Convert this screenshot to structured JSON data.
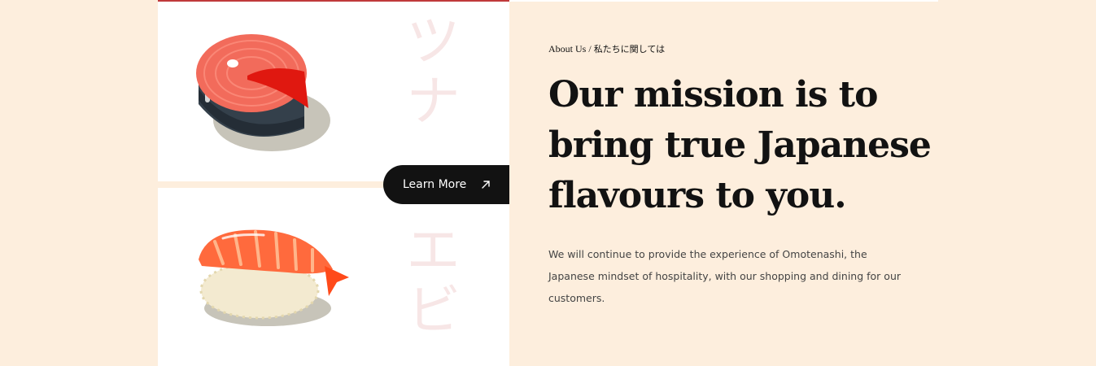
{
  "about": {
    "breadcrumb_en": "About Us",
    "breadcrumb_sep": "/",
    "breadcrumb_jp": "私たちに関しては",
    "headline": "Our mission is to bring true Japanese flavours to you.",
    "body": "We will continue to provide the experience of Omotenashi, the Japanese mindset of hospitality, with our shopping and dining for our customers."
  },
  "cards": {
    "top_kana": "ツナ",
    "bottom_kana": "エビ"
  },
  "cta": {
    "label": "Learn More",
    "icon": "arrow-up-right-icon"
  },
  "colors": {
    "page_bg": "#fdeedd",
    "card_bg": "#ffffff",
    "accent_red": "#c0393b",
    "button_bg": "#121212",
    "kana_tint": "#f7e6e6"
  }
}
